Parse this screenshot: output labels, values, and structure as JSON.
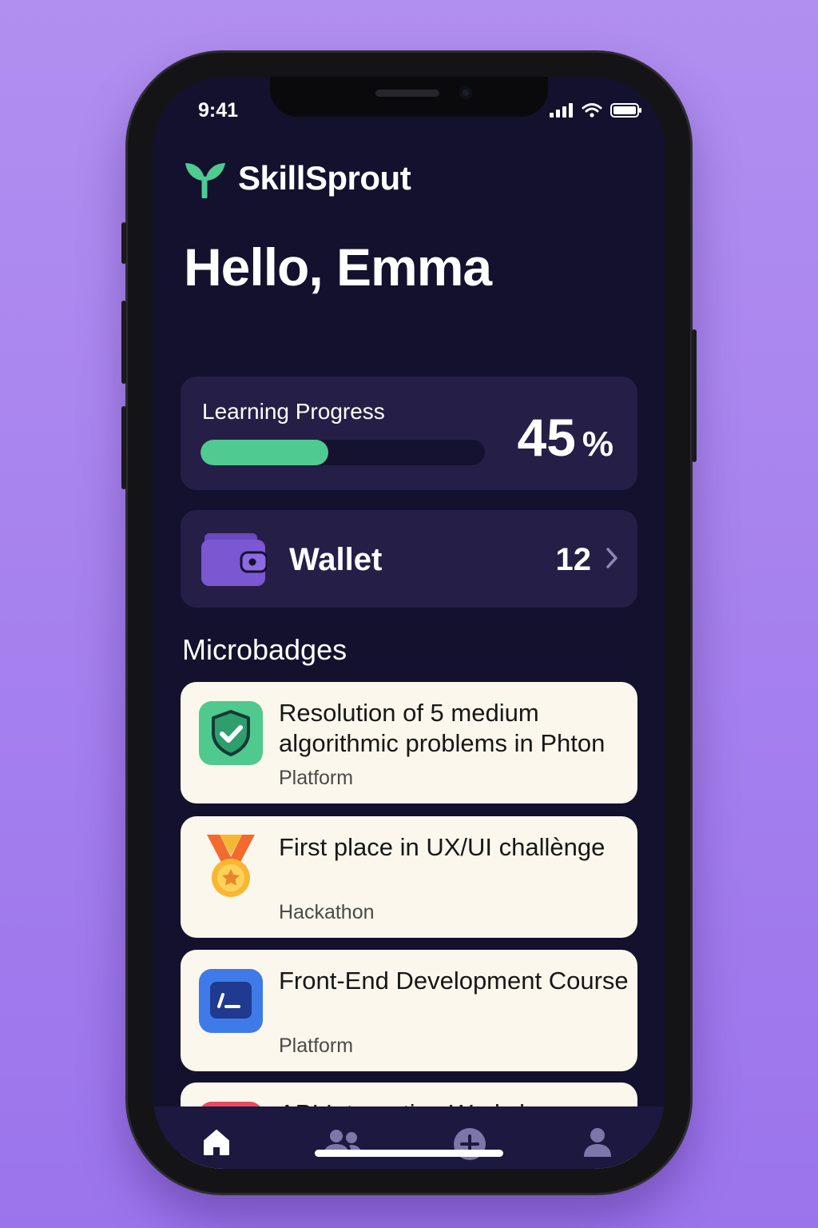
{
  "status_bar": {
    "time": "9:41"
  },
  "app": {
    "name": "SkillSprout",
    "logo_icon": "sprout-icon",
    "accent": "#4fca91"
  },
  "greeting": "Hello, Emma",
  "progress": {
    "title": "Learning Progress",
    "percent": 45,
    "value_label": "45",
    "unit": "%"
  },
  "wallet": {
    "label": "Wallet",
    "count": "12",
    "icon": "wallet-icon",
    "color": "#7b57d1"
  },
  "microbadges": {
    "title": "Microbadges",
    "items": [
      {
        "title": "Resolution of 5 medium algorithmic problems in Phton",
        "source": "Platform",
        "icon": "shield-check-icon",
        "color": "#4fc98e"
      },
      {
        "title": "First place in UX/UI challènge",
        "source": "Hackathon",
        "icon": "medal-icon",
        "color": "#f7b733"
      },
      {
        "title": "Front-End Development Course",
        "source": "Platform",
        "icon": "terminal-icon",
        "color": "#3e7be8"
      },
      {
        "title": "API Integration Workshop",
        "source": "",
        "icon": "code-icon",
        "color": "#ea4a5f"
      }
    ]
  },
  "tabbar": {
    "items": [
      {
        "name": "home",
        "icon": "home-icon",
        "active": true
      },
      {
        "name": "community",
        "icon": "people-icon",
        "active": false
      },
      {
        "name": "add",
        "icon": "plus-circle-icon",
        "active": false
      },
      {
        "name": "profile",
        "icon": "person-icon",
        "active": false
      }
    ]
  }
}
